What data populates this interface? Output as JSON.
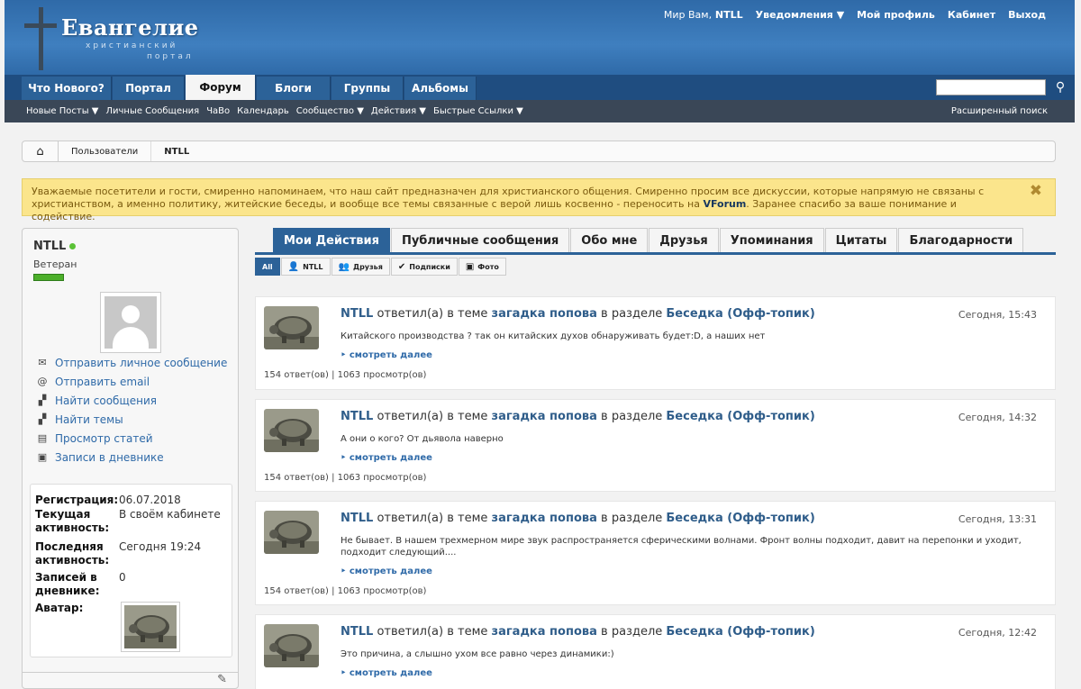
{
  "header": {
    "logo_title": "Евангелие",
    "logo_sub1": "христианский",
    "logo_sub2": "портал",
    "welcome": "Мир Вам,",
    "username": "NTLL",
    "notifications": "Уведомления ▼",
    "profile": "Мой профиль",
    "cabinet": "Кабинет",
    "logout": "Выход"
  },
  "tabs": [
    "Что Нового?",
    "Портал",
    "Форум",
    "Блоги",
    "Группы",
    "Альбомы"
  ],
  "subnav": {
    "items": [
      "Новые Посты ▼",
      "Личные Сообщения",
      "ЧаВо",
      "Календарь",
      "Сообщество ▼",
      "Действия ▼",
      "Быстрые Ссылки ▼"
    ],
    "advanced_search": "Расширенный поиск"
  },
  "breadcrumb": [
    "Пользователи",
    "NTLL"
  ],
  "notice": {
    "text_before": "Уважаемые посетители и гости, смиренно напоминаем, что наш сайт предназначен для христианского общения. Смиренно просим все дискуссии, которые напрямую не связаны с христианством, а именно политику, житейские беседы, и вообще все темы связанные с верой лишь косвенно - переносить на ",
    "link": "VForum",
    "text_after": ". Заранее спасибо за ваше понимание и содействие.",
    "close": "✖"
  },
  "profile": {
    "name": "NTLL",
    "rank": "Ветеран",
    "actions": [
      {
        "icon": "✉",
        "label": "Отправить личное сообщение"
      },
      {
        "icon": "@",
        "label": "Отправить email"
      },
      {
        "icon": "▞",
        "label": "Найти сообщения"
      },
      {
        "icon": "▞",
        "label": "Найти темы"
      },
      {
        "icon": "▤",
        "label": "Просмотр статей"
      },
      {
        "icon": "▣",
        "label": "Записи в дневнике"
      }
    ],
    "info": {
      "reg_label": "Регистрация:",
      "reg_value": "06.07.2018",
      "cur_label": "Текущая активность:",
      "cur_value": "В своём кабинете",
      "last_label": "Последняя активность:",
      "last_value": "Сегодня 19:24",
      "diary_label": "Записей в дневнике:",
      "diary_value": "0",
      "avatar_label": "Аватар:"
    }
  },
  "main_tabs": [
    "Мои Действия",
    "Публичные сообщения",
    "Обо мне",
    "Друзья",
    "Упоминания",
    "Цитаты",
    "Благодарности"
  ],
  "filters": [
    {
      "icon": "",
      "label": "All"
    },
    {
      "icon": "👤",
      "label": "NTLL"
    },
    {
      "icon": "👥",
      "label": "Друзья"
    },
    {
      "icon": "✔",
      "label": "Подписки"
    },
    {
      "icon": "▣",
      "label": "Фото"
    }
  ],
  "activity_common": {
    "user": "NTLL",
    "verb1": "ответил(а) в теме",
    "topic": "загадка попова",
    "verb2": "в разделе",
    "forum": "Беседка (Офф-топик)",
    "more": "смотреть далее",
    "stats": "154 ответ(ов) | 1063 просмотр(ов)"
  },
  "activities": [
    {
      "time": "Сегодня, 15:43",
      "text": "Китайского производства ? так он китайских духов обнаруживать будет:D, а наших нет"
    },
    {
      "time": "Сегодня, 14:32",
      "text": "А они о кого? От дьявола наверно"
    },
    {
      "time": "Сегодня, 13:31",
      "text": "Не бывает. В нашем трехмерном мире звук распространяется сферическими волнами. Фронт волны подходит, давит на перепонки и уходит, подходит следующий...."
    },
    {
      "time": "Сегодня, 12:42",
      "text": "Это причина, а слышно ухом все равно через динамики:)"
    }
  ],
  "colors": {
    "brand": "#2c6298",
    "link": "#2f5d8a",
    "notice_bg": "#fbe58c",
    "subnav_bg": "#3a4757"
  }
}
